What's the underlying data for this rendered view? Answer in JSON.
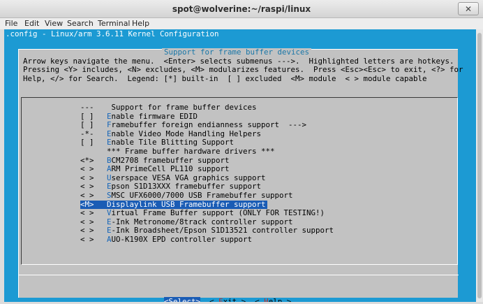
{
  "window": {
    "title": "spot@wolverine:~/raspi/linux",
    "close_glyph": "✕"
  },
  "menubar": [
    "File",
    "Edit",
    "View",
    "Search",
    "Terminal",
    "Help"
  ],
  "terminal": {
    "config_title": ".config - Linux/arm 3.6.11 Kernel Configuration",
    "dialog_title": "Support for frame buffer devices",
    "help_lines": [
      "Arrow keys navigate the menu.  <Enter> selects submenus --->.  Highlighted letters are hotkeys.",
      "Pressing <Y> includes, <N> excludes, <M> modularizes features.  Press <Esc><Esc> to exit, <?> for",
      "Help, </> for Search.  Legend: [*] built-in  [ ] excluded  <M> module  < > module capable"
    ],
    "items": [
      {
        "mark": "---",
        "hot": "",
        "rest": " Support for frame buffer devices"
      },
      {
        "mark": "[ ]",
        "hot": "E",
        "rest": "nable firmware EDID"
      },
      {
        "mark": "[ ]",
        "hot": "F",
        "rest": "ramebuffer foreign endianness support  --->"
      },
      {
        "mark": "-*-",
        "hot": "E",
        "rest": "nable Video Mode Handling Helpers"
      },
      {
        "mark": "[ ]",
        "hot": "E",
        "rest": "nable Tile Blitting Support"
      },
      {
        "mark": "",
        "hot": "",
        "rest": "*** Frame buffer hardware drivers ***"
      },
      {
        "mark": "<*>",
        "hot": "B",
        "rest": "CM2708 framebuffer support"
      },
      {
        "mark": "< >",
        "hot": "A",
        "rest": "RM PrimeCell PL110 support"
      },
      {
        "mark": "< >",
        "hot": "U",
        "rest": "serspace VESA VGA graphics support"
      },
      {
        "mark": "< >",
        "hot": "E",
        "rest": "pson S1D13XXX framebuffer support"
      },
      {
        "mark": "< >",
        "hot": "S",
        "rest": "MSC UFX6000/7000 USB Framebuffer support"
      },
      {
        "mark": "<M>",
        "hot": "D",
        "rest": "isplaylink USB Framebuffer support",
        "selected": true
      },
      {
        "mark": "< >",
        "hot": "V",
        "rest": "irtual Frame Buffer support (ONLY FOR TESTING!)"
      },
      {
        "mark": "< >",
        "hot": "E",
        "rest": "-Ink Metronome/8track controller support"
      },
      {
        "mark": "< >",
        "hot": "E",
        "rest": "-Ink Broadsheet/Epson S1D13521 controller support"
      },
      {
        "mark": "< >",
        "hot": "A",
        "rest": "UO-K190X EPD controller support"
      }
    ],
    "buttons": [
      {
        "pre": "<",
        "hot": "S",
        "rest": "elect",
        "post": ">",
        "selected": true
      },
      {
        "pre": "< ",
        "hot": "E",
        "rest": "xit",
        "post": " >"
      },
      {
        "pre": "< ",
        "hot": "H",
        "rest": "elp",
        "post": " >"
      }
    ]
  },
  "colors": {
    "terminal_bg": "#1c9ad3",
    "dialog_bg": "#c2c2c2",
    "selection_bg": "#1a5cb5",
    "hotkey": "#1565b8"
  }
}
